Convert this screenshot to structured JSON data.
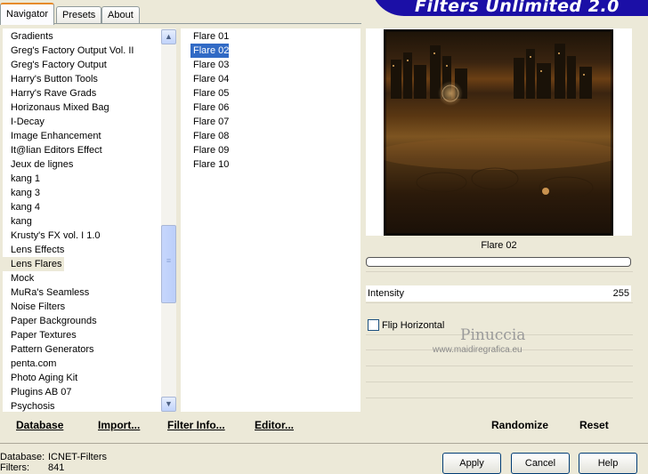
{
  "tabs": [
    "Navigator",
    "Presets",
    "About"
  ],
  "banner_title": "Filters Unlimited 2.0",
  "categories": [
    "Gradients",
    "Greg's Factory Output Vol. II",
    "Greg's Factory Output",
    "Harry's Button Tools",
    "Harry's Rave Grads",
    "Horizonaus Mixed Bag",
    "I-Decay",
    "Image Enhancement",
    "It@lian Editors Effect",
    "Jeux de lignes",
    "kang 1",
    "kang 3",
    "kang 4",
    "kang",
    "Krusty's FX vol. I 1.0",
    "Lens Effects",
    "Lens Flares",
    "Mock",
    "MuRa's Seamless",
    "Noise Filters",
    "Paper Backgrounds",
    "Paper Textures",
    "Pattern Generators",
    "penta.com",
    "Photo Aging Kit",
    "Plugins AB 07",
    "Psychosis"
  ],
  "selected_category": "Lens Flares",
  "filters": [
    "Flare 01",
    "Flare 02",
    "Flare 03",
    "Flare 04",
    "Flare 05",
    "Flare 06",
    "Flare 07",
    "Flare 08",
    "Flare 09",
    "Flare 10"
  ],
  "selected_filter": "Flare 02",
  "preview_caption": "Flare 02",
  "intensity": {
    "label": "Intensity",
    "value": "255"
  },
  "flip_horizontal": {
    "label": "Flip Horizontal",
    "checked": false
  },
  "watermark": {
    "name": "Pinuccia",
    "url": "www.maidiregrafica.eu"
  },
  "left_buttons": [
    "Database",
    "Import...",
    "Filter Info...",
    "Editor..."
  ],
  "right_buttons": [
    "Randomize",
    "Reset"
  ],
  "dialog_buttons": [
    "Apply",
    "Cancel",
    "Help"
  ],
  "status": {
    "database_label": "Database:",
    "database_value": "ICNET-Filters",
    "filters_label": "Filters:",
    "filters_value": "841"
  }
}
